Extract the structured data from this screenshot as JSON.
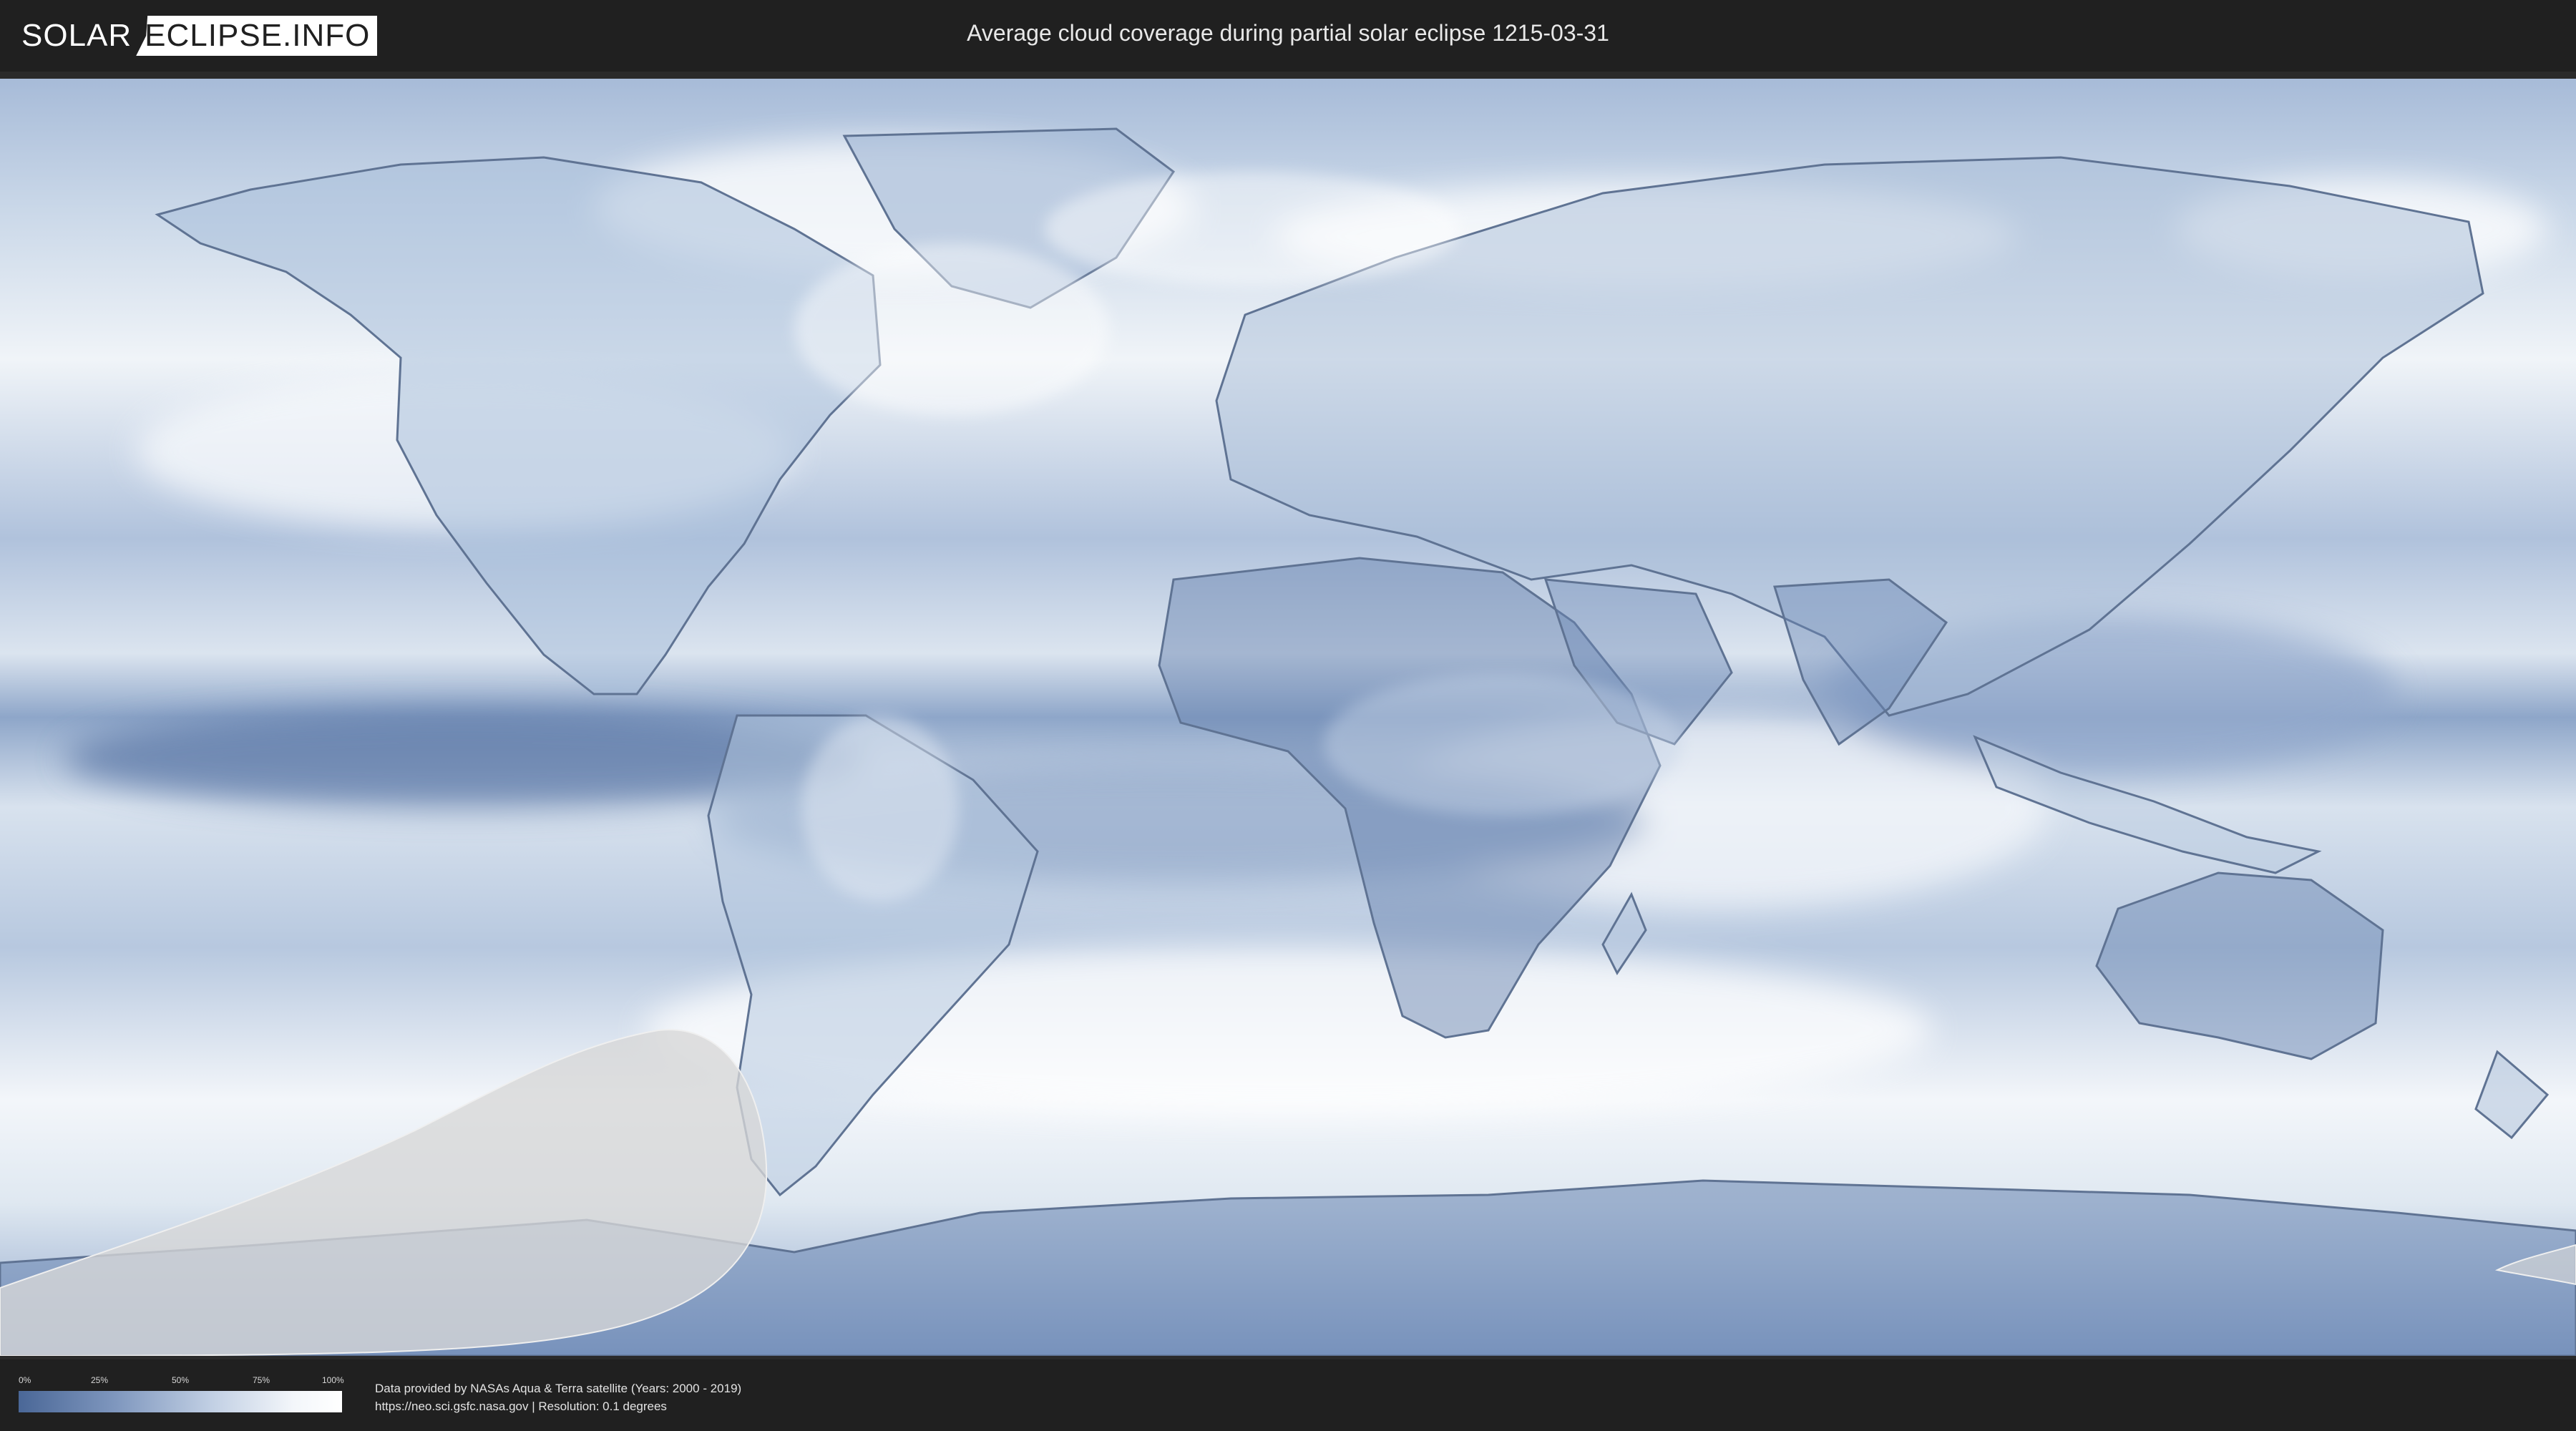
{
  "header": {
    "logo_left": "SOLAR",
    "logo_right": "ECLIPSE.INFO",
    "title": "Average cloud coverage during partial solar eclipse 1215-03-31"
  },
  "map": {
    "colors": {
      "cloud_low": "#4a6797",
      "cloud_mid": "#9db1d0",
      "cloud_high": "#ffffff",
      "eclipse_zone": "#d7d7d7",
      "land_outline": "#50627f"
    }
  },
  "legend": {
    "ticks": [
      "0%",
      "25%",
      "50%",
      "75%",
      "100%"
    ]
  },
  "footer": {
    "source_line_1": "Data provided by NASAs Aqua & Terra satellite (Years: 2000 - 2019)",
    "source_line_2": "https://neo.sci.gsfc.nasa.gov | Resolution: 0.1 degrees"
  }
}
